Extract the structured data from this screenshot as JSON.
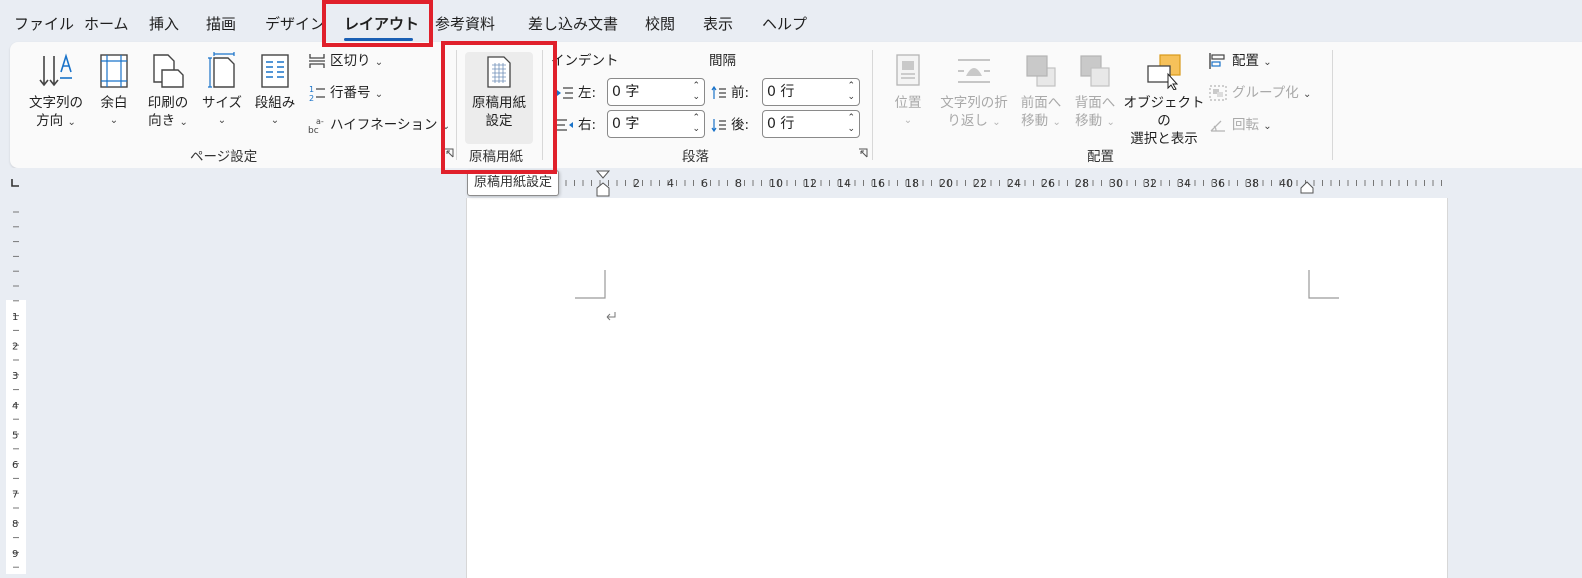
{
  "tabs": [
    "ファイル",
    "ホーム",
    "挿入",
    "描画",
    "デザイン",
    "レイアウト",
    "参考資料",
    "差し込み文書",
    "校閲",
    "表示",
    "ヘルプ"
  ],
  "active_tab": "レイアウト",
  "page_setup": {
    "text_direction": [
      "文字列の",
      "方向"
    ],
    "margins": "余白",
    "orientation": [
      "印刷の",
      "向き"
    ],
    "size": "サイズ",
    "columns": "段組み",
    "breaks": "区切り",
    "line_numbers": "行番号",
    "hyphenation": "ハイフネーション",
    "group_label": "ページ設定"
  },
  "genko": {
    "button": [
      "原稿用紙",
      "設定"
    ],
    "group_label": "原稿用紙"
  },
  "paragraph": {
    "indent_label": "インデント",
    "spacing_label": "間隔",
    "left_label": "左:",
    "right_label": "右:",
    "before_label": "前:",
    "after_label": "後:",
    "left_value": "0 字",
    "right_value": "0 字",
    "before_value": "0 行",
    "after_value": "0 行",
    "group_label": "段落"
  },
  "arrange": {
    "position": "位置",
    "wrap_text": [
      "文字列の折",
      "り返し"
    ],
    "bring_forward": [
      "前面へ",
      "移動"
    ],
    "send_backward": [
      "背面へ",
      "移動"
    ],
    "selection_pane": [
      "オブジェクトの",
      "選択と表示"
    ],
    "align": "配置",
    "group": "グループ化",
    "rotate": "回転",
    "group_label": "配置"
  },
  "tooltip": "原稿用紙設定",
  "ruler_labels": [
    "2",
    "4",
    "6",
    "8",
    "10",
    "12",
    "14",
    "16",
    "18",
    "20",
    "22",
    "24",
    "26",
    "28",
    "30",
    "32",
    "34",
    "36",
    "38",
    "40"
  ],
  "vruler_labels": [
    "1",
    "2",
    "3",
    "4",
    "5",
    "6",
    "7",
    "8",
    "9"
  ],
  "colors": {
    "highlight": "#e0202b",
    "accent": "#1a5fb4"
  }
}
